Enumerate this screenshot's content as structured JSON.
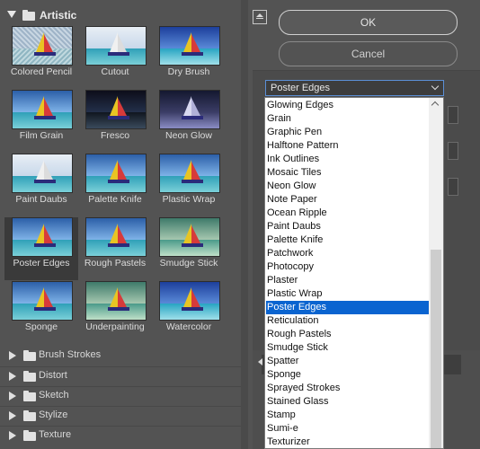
{
  "gallery": {
    "open_category": "Artistic",
    "filters": [
      {
        "label": "Colored Pencil",
        "style": "pencil"
      },
      {
        "label": "Cutout",
        "style": "white"
      },
      {
        "label": "Dry Brush",
        "style": "water"
      },
      {
        "label": "Film Grain",
        "style": "normal"
      },
      {
        "label": "Fresco",
        "style": "dark"
      },
      {
        "label": "Neon Glow",
        "style": "glow"
      },
      {
        "label": "Paint Daubs",
        "style": "white"
      },
      {
        "label": "Palette Knife",
        "style": "normal"
      },
      {
        "label": "Plastic Wrap",
        "style": "normal"
      },
      {
        "label": "Poster Edges",
        "style": "normal",
        "selected": true
      },
      {
        "label": "Rough Pastels",
        "style": "normal"
      },
      {
        "label": "Smudge Stick",
        "style": "green"
      },
      {
        "label": "Sponge",
        "style": "normal"
      },
      {
        "label": "Underpainting",
        "style": "green"
      },
      {
        "label": "Watercolor",
        "style": "water"
      }
    ],
    "collapsed_categories": [
      "Brush Strokes",
      "Distort",
      "Sketch",
      "Stylize",
      "Texture"
    ]
  },
  "buttons": {
    "ok_label": "OK",
    "cancel_label": "Cancel"
  },
  "filter_select": {
    "value": "Poster Edges",
    "options": [
      "Glowing Edges",
      "Grain",
      "Graphic Pen",
      "Halftone Pattern",
      "Ink Outlines",
      "Mosaic Tiles",
      "Neon Glow",
      "Note Paper",
      "Ocean Ripple",
      "Paint Daubs",
      "Palette Knife",
      "Patchwork",
      "Photocopy",
      "Plaster",
      "Plastic Wrap",
      "Poster Edges",
      "Reticulation",
      "Rough Pastels",
      "Smudge Stick",
      "Spatter",
      "Sponge",
      "Sprayed Strokes",
      "Stained Glass",
      "Stamp",
      "Sumi-e",
      "Texturizer"
    ],
    "highlighted": "Poster Edges"
  },
  "colors": {
    "panel_bg": "#535353",
    "selection_blue": "#0a64d0",
    "select_border": "#5b8fd6"
  }
}
